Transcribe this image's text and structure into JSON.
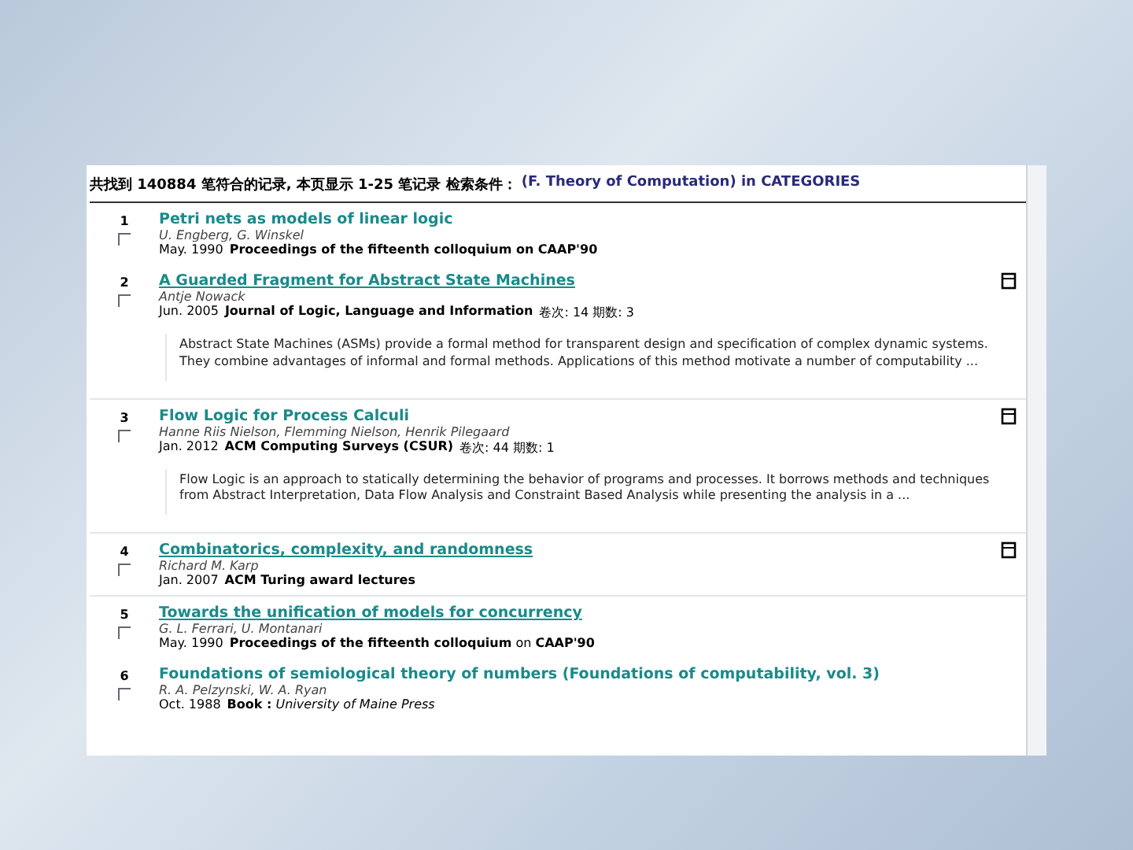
{
  "header": {
    "summary": "共找到 140884 笔符合的记录, 本页显示 1-25 笔记录 检索条件：",
    "query": "(F. Theory of Computation) in CATEGORIES"
  },
  "results": [
    {
      "number": "1",
      "checked": false,
      "title": "Petri nets as models of linear logic",
      "underlined": false,
      "authors": "U. Engberg,  G. Winskel",
      "date": "May. 1990",
      "venue": "**Proceedings of the fifteenth colloquium on CAAP'90**",
      "icon": false
    },
    {
      "number": "2",
      "checked": false,
      "title": "A Guarded Fragment for Abstract State Machines",
      "underlined": true,
      "authors": "Antje Nowack",
      "date": "Jun. 2005",
      "venue": "**Journal of Logic, Language and Information**",
      "issue": "卷次: 14 期数: 3",
      "icon": true,
      "abstract": "Abstract State Machines (ASMs) provide a formal method for transparent design and specification of complex dynamic systems. They combine advantages of informal and formal methods. Applications of this method motivate a number of computability ..."
    },
    {
      "number": "3",
      "checked": false,
      "title": "Flow Logic for Process Calculi",
      "underlined": false,
      "authors": "Hanne Riis Nielson,  Flemming Nielson,  Henrik Pilegaard",
      "date": "Jan. 2012",
      "venue": "**ACM Computing Surveys (CSUR)**",
      "issue": "卷次: 44 期数: 1",
      "icon": true,
      "abstract": "Flow Logic is an approach to statically determining the behavior of programs and processes. It borrows methods and techniques from Abstract Interpretation, Data Flow Analysis and Constraint Based Analysis while presenting the analysis in a ..."
    },
    {
      "number": "4",
      "checked": false,
      "title": "Combinatorics, complexity, and randomness",
      "underlined": true,
      "authors": "Richard M. Karp",
      "date": "Jan. 2007",
      "venue": "**ACM Turing award lectures**",
      "icon": true
    },
    {
      "number": "5",
      "checked": false,
      "title": "Towards the unification of models for concurrency",
      "underlined": true,
      "authors": "G. L. Ferrari,  U. Montanari",
      "date": "May. 1990",
      "venue": "**Proceedings of the fifteenth colloquium** on **CAAP'90**",
      "icon": false
    },
    {
      "number": "6",
      "checked": false,
      "title": "Foundations of semiological theory of numbers (Foundations of computability, vol. 3)",
      "underlined": false,
      "authors": "R. A. Pelzynski,  W. A. Ryan",
      "date": "Oct. 1988",
      "venue": "**Book :** *University of Maine Press*",
      "icon": false
    }
  ]
}
